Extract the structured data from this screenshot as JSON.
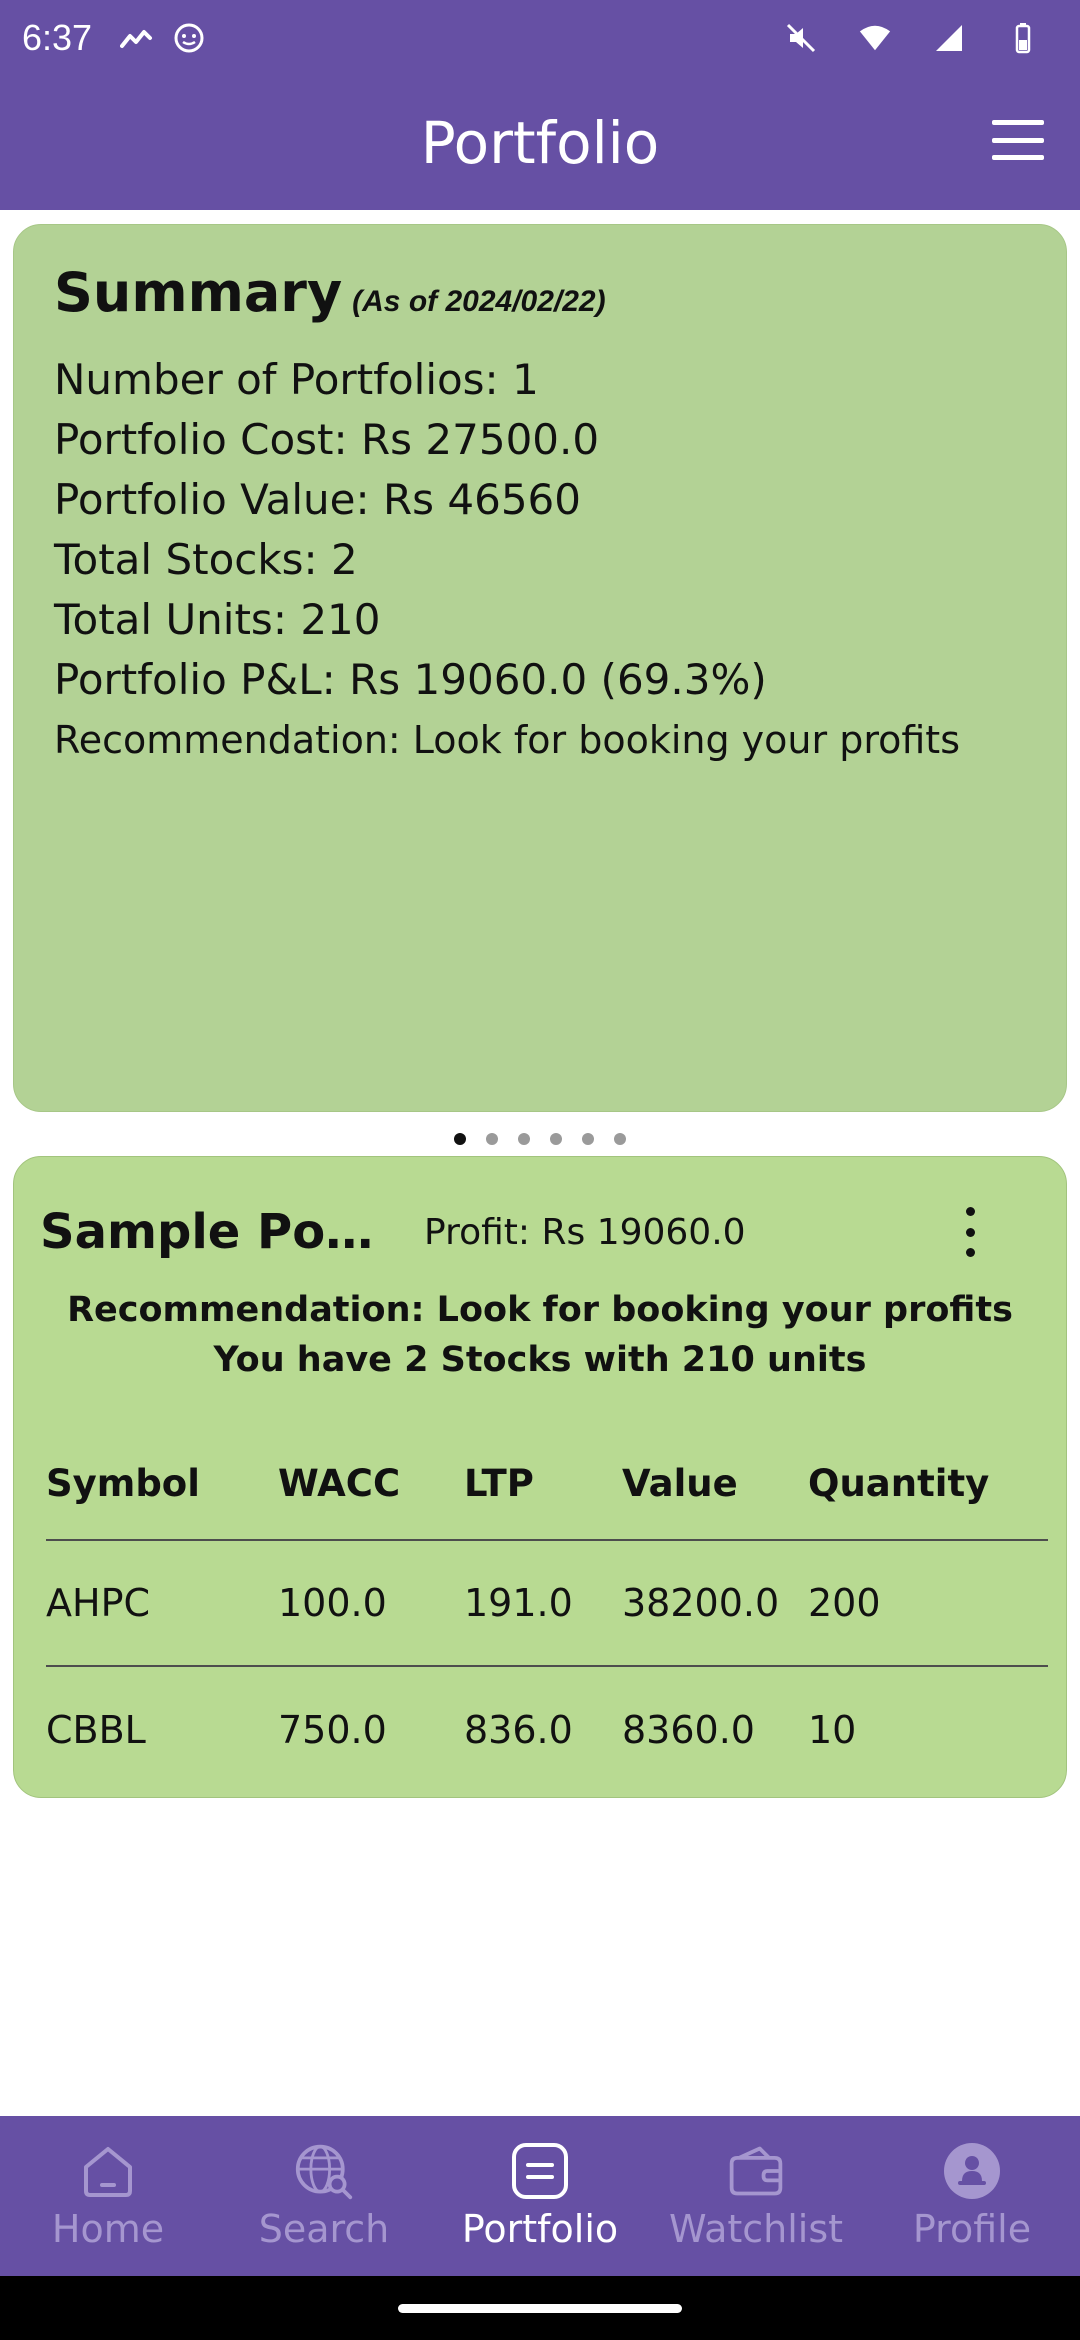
{
  "status_bar": {
    "time": "6:37"
  },
  "app_bar": {
    "title": "Portfolio"
  },
  "summary": {
    "title": "Summary",
    "as_of": "(As of 2024/02/22)",
    "lines": [
      "Number of Portfolios:  1",
      "Portfolio Cost: Rs 27500.0",
      "Portfolio Value: Rs  46560",
      "Total Stocks: 2",
      "Total Units:  210",
      "Portfolio P&L: Rs 19060.0 (69.3%)"
    ],
    "recommendation": "Recommendation:  Look for booking your profits"
  },
  "pager": {
    "count": 6,
    "active_index": 0
  },
  "portfolio_card": {
    "name": "Sample Portf...",
    "profit": "Profit: Rs 19060.0",
    "recommendation": "Recommendation:  Look for booking your profits",
    "stocks_info": "You have 2 Stocks with 210 units",
    "columns": [
      "Symbol",
      "WACC",
      "LTP",
      "Value",
      "Quantity"
    ],
    "rows": [
      [
        "AHPC",
        "100.0",
        "191.0",
        "38200.0",
        "200"
      ],
      [
        "CBBL",
        "750.0",
        "836.0",
        "8360.0",
        "10"
      ]
    ]
  },
  "bottom_nav": {
    "items": [
      {
        "label": "Home",
        "icon": "home-icon",
        "active": false
      },
      {
        "label": "Search",
        "icon": "globe-search-icon",
        "active": false
      },
      {
        "label": "Portfolio",
        "icon": "portfolio-icon",
        "active": true
      },
      {
        "label": "Watchlist",
        "icon": "wallet-icon",
        "active": false
      },
      {
        "label": "Profile",
        "icon": "profile-icon",
        "active": false
      }
    ]
  },
  "colors": {
    "primary": "#6650a4",
    "summary_card": "#b3d295",
    "portfolio_card": "#b8da92",
    "nav_inactive": "#a596cf"
  }
}
